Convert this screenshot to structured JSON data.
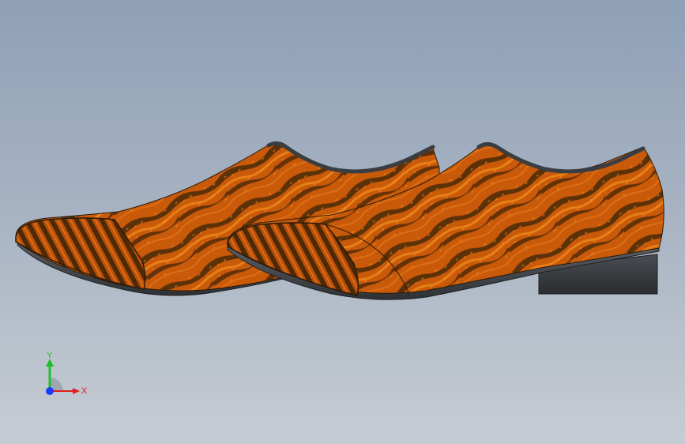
{
  "viewport": {
    "background_top": "#8fa0b6",
    "background_bottom": "#c6ccd3"
  },
  "model": {
    "objects": [
      "shoe-left",
      "shoe-right"
    ],
    "upper_texture_colors": [
      "#c85a0a",
      "#e0760f",
      "#4a2a08"
    ],
    "sole_color": "#4b4e52",
    "heel_color": "#3f4246"
  },
  "triad": {
    "y_label": "Y",
    "x_label": "X",
    "y_color": "#1fbf2a",
    "x_color": "#e0201a",
    "z_color": "#1a3cff"
  }
}
